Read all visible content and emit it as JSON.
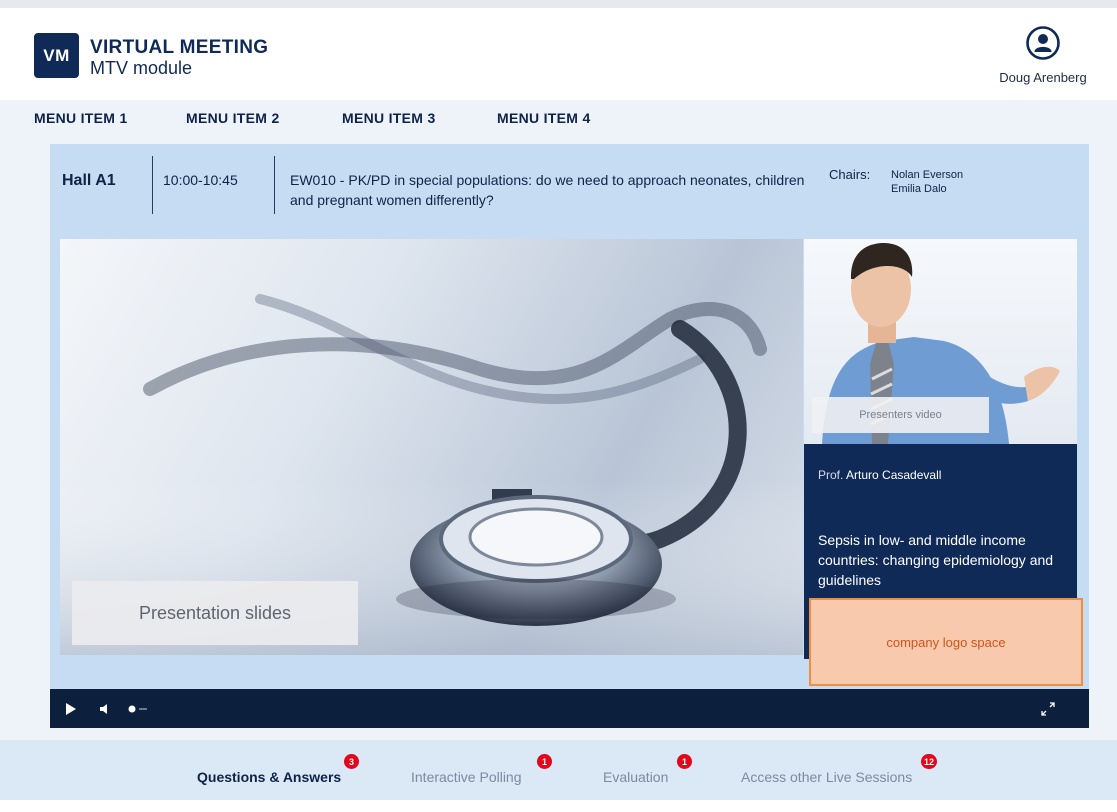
{
  "brand": {
    "logo_text": "VM",
    "title": "VIRTUAL MEETING",
    "subtitle": "MTV module"
  },
  "user": {
    "name": "Doug Arenberg",
    "icon": "user-circle-icon"
  },
  "menu": {
    "items": [
      "MENU ITEM 1",
      "MENU ITEM 2",
      "MENU ITEM 3",
      "MENU ITEM 4"
    ]
  },
  "session": {
    "hall": "Hall A1",
    "time": "10:00-10:45",
    "title": "EW010 - PK/PD in special populations: do we need to approach neonates, children and pregnant women differently?",
    "chairs_label": "Chairs:",
    "chairs": [
      "Nolan Everson",
      "Emilia Dalo"
    ]
  },
  "slides": {
    "label": "Presentation slides"
  },
  "presenter": {
    "video_label": "Presenters video",
    "prefix": "Prof.",
    "name": "Arturo Casadevall",
    "talk": "Sepsis in low- and middle income countries: changing epidemiology and guidelines"
  },
  "company_logo": {
    "label": "company logo space"
  },
  "controls": {
    "icons": [
      "play-icon",
      "volume-icon",
      "volume-slider",
      "fullscreen-icon"
    ]
  },
  "tabs": [
    {
      "label": "Questions & Answers",
      "badge": "3",
      "active": true
    },
    {
      "label": "Interactive Polling",
      "badge": "1",
      "active": false
    },
    {
      "label": "Evaluation",
      "badge": "1",
      "active": false
    },
    {
      "label": "Access other Live Sessions",
      "badge": "12",
      "active": false
    }
  ],
  "colors": {
    "brand_navy": "#0f2a57",
    "panel_blue": "#c5dcf3",
    "badge_red": "#e3071b",
    "logo_space_fill": "#f9c9ad",
    "logo_space_border": "#ec8f45"
  }
}
